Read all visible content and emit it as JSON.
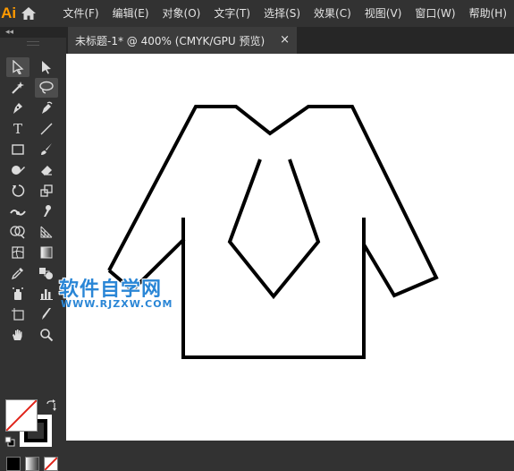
{
  "app": {
    "logo": "Ai",
    "home_icon": "home-icon"
  },
  "menu": {
    "items": [
      {
        "label": "文件(F)"
      },
      {
        "label": "编辑(E)"
      },
      {
        "label": "对象(O)"
      },
      {
        "label": "文字(T)"
      },
      {
        "label": "选择(S)"
      },
      {
        "label": "效果(C)"
      },
      {
        "label": "视图(V)"
      },
      {
        "label": "窗口(W)"
      },
      {
        "label": "帮助(H)"
      }
    ]
  },
  "panel": {
    "collapse_label": "◂◂"
  },
  "document_tab": {
    "title": "未标题-1* @ 400% (CMYK/GPU 预览)",
    "close_glyph": "×"
  },
  "toolbar": {
    "type_tool_glyph": "T",
    "tools": [
      "selection-tool",
      "direct-selection-tool",
      "magic-wand-tool",
      "lasso-tool",
      "pen-tool",
      "curvature-tool",
      "type-tool",
      "line-segment-tool",
      "rectangle-tool",
      "paintbrush-tool",
      "shaper-tool",
      "eraser-tool",
      "rotate-tool",
      "scale-tool",
      "width-tool",
      "puppet-warp-tool",
      "shape-builder-tool",
      "perspective-grid-tool",
      "mesh-tool",
      "gradient-tool",
      "eyedropper-tool",
      "blend-tool",
      "symbol-sprayer-tool",
      "column-graph-tool",
      "artboard-tool",
      "slice-tool",
      "hand-tool",
      "zoom-tool"
    ],
    "fill_color": "#ffffff",
    "stroke_color": "#000000"
  },
  "colors": {
    "accent": "#ff9a00",
    "watermark": "#2a86d6"
  },
  "watermark": {
    "text": "软件自学网",
    "url": "WWW.RJZXW.COM"
  }
}
